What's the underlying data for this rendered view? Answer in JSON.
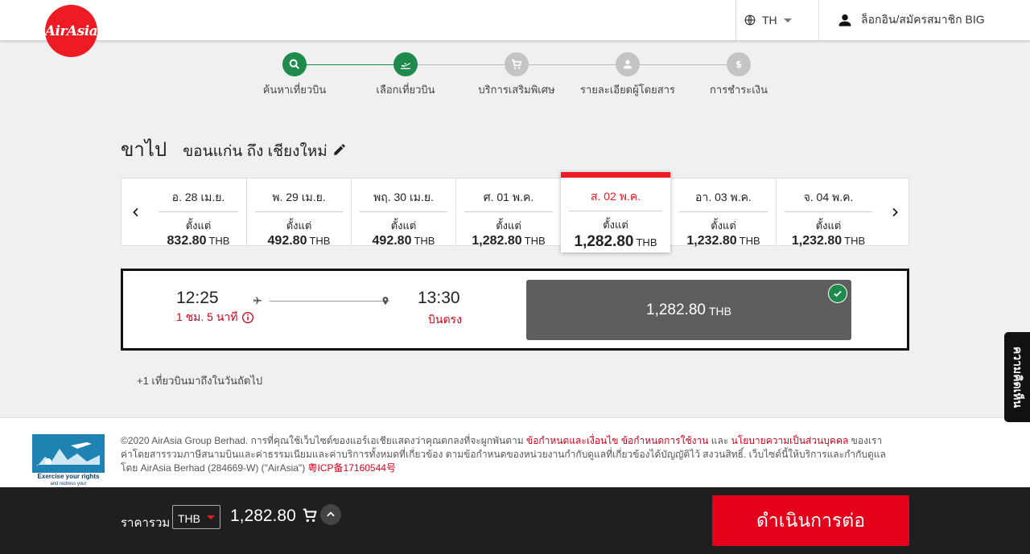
{
  "header": {
    "logo_text": "AirAsia",
    "language": "TH",
    "login_label": "ล็อกอิน/สมัครสมาชิก BIG"
  },
  "stepper": {
    "steps": [
      {
        "label": "ค้นหาเที่ยวบิน",
        "icon": "search-icon",
        "status": "completed"
      },
      {
        "label": "เลือกเที่ยวบิน",
        "icon": "flight-departure-icon",
        "status": "current"
      },
      {
        "label": "บริการเสริมพิเศษ",
        "icon": "cart-icon",
        "status": "upcoming"
      },
      {
        "label": "รายละเอียดผู้โดยสาร",
        "icon": "person-icon",
        "status": "upcoming"
      },
      {
        "label": "การชำระเงิน",
        "icon": "dollar-icon",
        "status": "upcoming"
      }
    ],
    "active_color": "#1e8a4c",
    "inactive_color": "#c4c4c4"
  },
  "route": {
    "leg": "ขาไป",
    "origin_destination": "ขอนแก่น ถึง เชียงใหม่"
  },
  "dates": {
    "from_label": "ตั้งแต่",
    "currency": "THB",
    "items": [
      {
        "date": "อ. 28 เม.ย.",
        "price": "832.80"
      },
      {
        "date": "พ. 29 เม.ย.",
        "price": "492.80"
      },
      {
        "date": "พฤ. 30 เม.ย.",
        "price": "492.80"
      },
      {
        "date": "ศ. 01 พ.ค.",
        "price": "1,282.80"
      },
      {
        "date": "ส. 02 พ.ค.",
        "price": "1,282.80",
        "selected": true
      },
      {
        "date": "อา. 03 พ.ค.",
        "price": "1,232.80"
      },
      {
        "date": "จ. 04 พ.ค.",
        "price": "1,232.80"
      }
    ]
  },
  "flight": {
    "depart_time": "12:25",
    "duration": "1 ชม. 5 นาที",
    "arrive_time": "13:30",
    "stops": "บินตรง",
    "fare_amount": "1,282.80",
    "fare_currency": "THB"
  },
  "next_day_note": "+1 เที่ยวบินมาถึงในวันถัดไป",
  "footer": {
    "badge_line1": "Exercise your rights",
    "badge_line2": "and redress your",
    "legal_1": "©2020 AirAsia Group Berhad. การที่คุณใช้เว็บไซต์ของแอร์เอเชียแสดงว่าคุณตกลงที่จะผูกพันตาม",
    "link_terms": "ข้อกำหนดและเงื่อนไข",
    "link_terms_use": "ข้อกำหนดการใช้งาน",
    "and": "และ",
    "link_privacy": "นโยบายความเป็นส่วนบุคคล",
    "legal_2": "ของเราค่าโดยสารรวมภาษีสนามบินและค่าธรรมเนียมและค่าบริการทั้งหมดที่เกี่ยวข้อง ตามข้อกำหนดของหน่วยงานกำกับดูแลที่เกี่ยวข้องได้บัญญัติไว้ สงวนสิทธิ์. เว็บไซต์นี้ให้บริการและกำกับดูแลโดย AirAsia Berhad (284669-W) (\"AirAsia\")",
    "icp": "粤ICP备17160544号"
  },
  "bottom_bar": {
    "total_label": "ราคารวม",
    "currency": "THB",
    "total_amount": "1,282.80",
    "continue_label": "ดำเนินการต่อ"
  },
  "feedback_label": "ความคิดเห็น",
  "colors": {
    "brand_red": "#ed1c24",
    "success_green": "#1e8a4c",
    "fare_block": "#5e5e5e"
  }
}
